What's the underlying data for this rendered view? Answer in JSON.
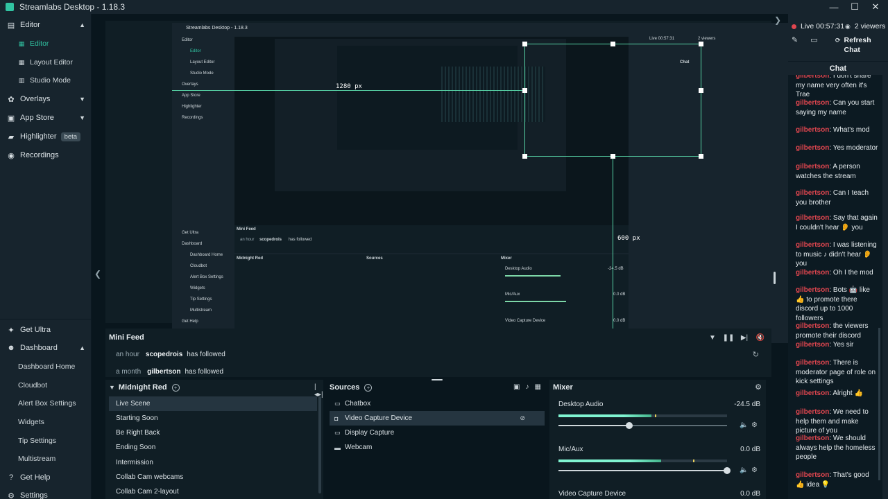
{
  "window": {
    "title": "Streamlabs Desktop - 1.18.3",
    "minimize": "—",
    "maximize": "☐",
    "close": "✕"
  },
  "sidebar": {
    "editor": {
      "label": "Editor",
      "subs": [
        "Editor",
        "Layout Editor",
        "Studio Mode"
      ]
    },
    "overlays": "Overlays",
    "app_store": "App Store",
    "highlighter": "Highlighter",
    "highlighter_badge": "beta",
    "recordings": "Recordings",
    "get_ultra": "Get Ultra",
    "dashboard": {
      "label": "Dashboard",
      "subs": [
        "Dashboard Home",
        "Cloudbot",
        "Alert Box Settings",
        "Widgets",
        "Tip Settings",
        "Multistream"
      ]
    },
    "get_help": "Get Help",
    "settings": "Settings"
  },
  "preview": {
    "width_label": "1280 px",
    "height_label": "600 px",
    "inner_width_label": "1280 px",
    "inner_height_label": "600 px",
    "mini_feed": "Mini Feed",
    "mini_user": "scopedrois",
    "mini_action": "has followed",
    "mini_time": "an hour",
    "scenes_title": "Midnight Red",
    "sources_title": "Sources",
    "mixer_title": "Mixer",
    "chat_title": "Chat",
    "live": "Live 00:57:31",
    "viewers": "2 viewers",
    "desktop_audio": "Desktop Audio",
    "desktop_db": "-24.5 dB",
    "mic": "Mic/Aux",
    "mic_db": "0.0 dB",
    "video_capture": "Video Capture Device",
    "video_db": "0.0 dB"
  },
  "minifeed": {
    "title": "Mini Feed",
    "rows": [
      {
        "time": "an hour",
        "user": "scopedrois",
        "action": "has followed"
      },
      {
        "time": "a month",
        "user": "gilbertson",
        "action": "has followed"
      }
    ]
  },
  "scenes": {
    "title": "Midnight Red",
    "items": [
      "Live Scene",
      "Starting Soon",
      "Be Right Back",
      "Ending Soon",
      "Intermission",
      "Collab Cam webcams",
      "Collab Cam 2-layout"
    ]
  },
  "sources": {
    "title": "Sources",
    "items": [
      "Chatbox",
      "Video Capture Device",
      "Display Capture",
      "Webcam"
    ]
  },
  "mixer": {
    "title": "Mixer",
    "channels": [
      {
        "name": "Desktop Audio",
        "db": "-24.5 dB",
        "meter": 0.55,
        "peak": 0.57,
        "volume": 0.42
      },
      {
        "name": "Mic/Aux",
        "db": "0.0 dB",
        "meter": 0.61,
        "peak": 0.8,
        "volume": 1.0
      },
      {
        "name": "Video Capture Device",
        "db": "0.0 dB",
        "meter": 0.0,
        "peak": 0.0,
        "volume": 0.0
      }
    ]
  },
  "chat": {
    "live": "Live 00:57:31",
    "viewers": "2 viewers",
    "refresh": "Refresh Chat",
    "title": "Chat",
    "messages": [
      {
        "nick": "gilbertson",
        "text": ": I don't share my name very often it's Trae"
      },
      {
        "nick": "gilbertson",
        "text": ": Can you start saying my name"
      },
      {
        "nick": "gilbertson",
        "text": ": What's mod"
      },
      {
        "nick": "gilbertson",
        "text": ": Yes moderator"
      },
      {
        "nick": "gilbertson",
        "text": ": A person watches the stream"
      },
      {
        "nick": "gilbertson",
        "text": ": Can I teach you brother"
      },
      {
        "nick": "gilbertson",
        "text": ": Say that again I couldn't hear 👂 you"
      },
      {
        "nick": "gilbertson",
        "text": ": I was listening to music ♪ didn't hear 👂 you"
      },
      {
        "nick": "gilbertson",
        "text": ": Oh I the mod"
      },
      {
        "nick": "gilbertson",
        "text": ": Bots 🤖 like 👍 to promote there discord up to 1000 followers"
      },
      {
        "nick": "gilbertson",
        "text": ": the viewers promote their discord"
      },
      {
        "nick": "gilbertson",
        "text": ": Yes sir"
      },
      {
        "nick": "gilbertson",
        "text": ": There is moderator page of role on kick settings"
      },
      {
        "nick": "gilbertson",
        "text": ": Alright 👍"
      },
      {
        "nick": "gilbertson",
        "text": ": We need to help them and make picture of you"
      },
      {
        "nick": "gilbertson",
        "text": ": We should always help the homeless people"
      },
      {
        "nick": "gilbertson",
        "text": ": That's good 👍 idea 💡"
      }
    ]
  },
  "colors": {
    "accent": "#31c3a2",
    "live_red": "#e0464f",
    "panel": "#17242d",
    "bg": "#09161d"
  }
}
